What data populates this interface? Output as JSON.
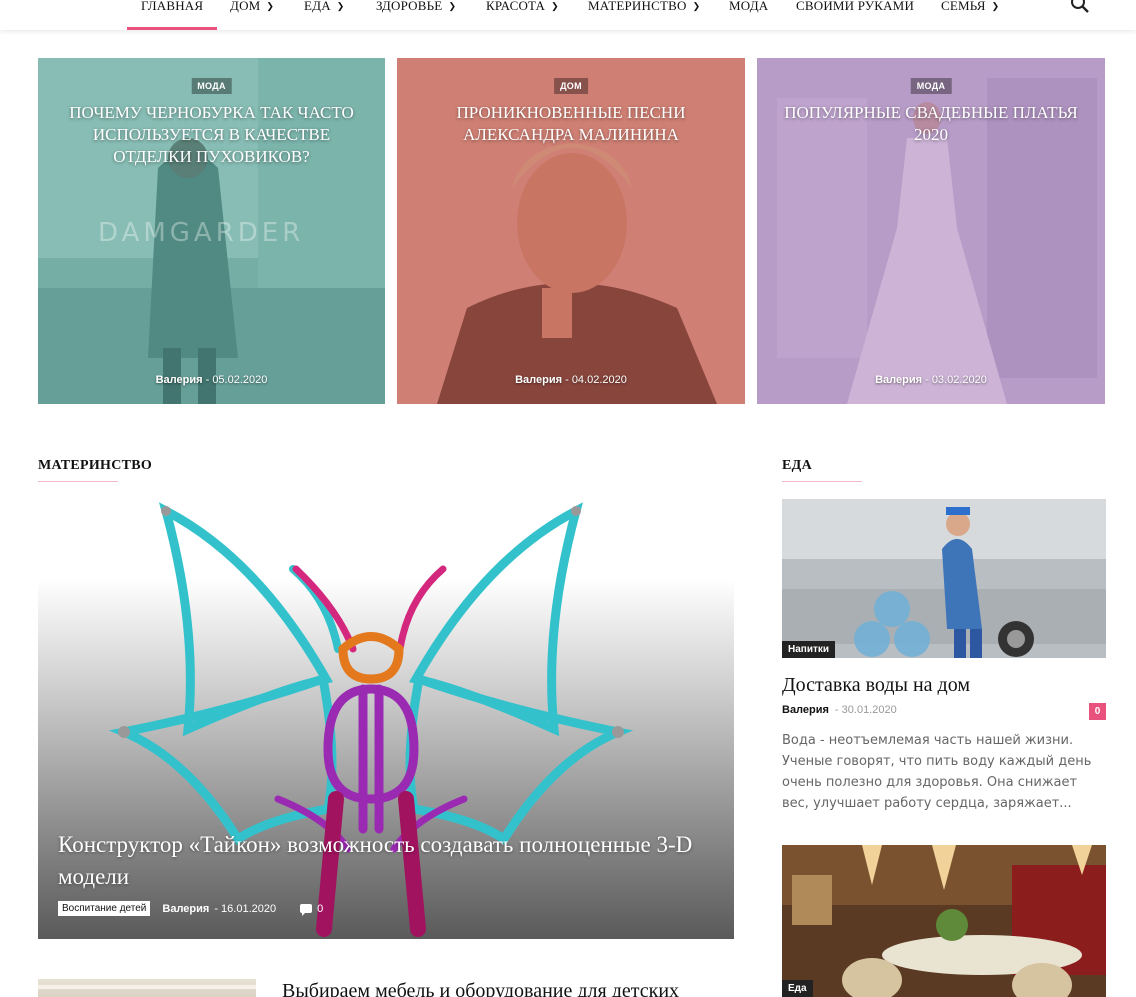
{
  "nav": {
    "items": [
      {
        "label": "ГЛАВНАЯ",
        "active": true,
        "dropdown": false
      },
      {
        "label": "ДОМ",
        "dropdown": true
      },
      {
        "label": "ЕДА",
        "dropdown": true
      },
      {
        "label": "ЗДОРОВЬЕ",
        "dropdown": true
      },
      {
        "label": "КРАСОТА",
        "dropdown": true
      },
      {
        "label": "МАТЕРИНСТВО",
        "dropdown": true
      },
      {
        "label": "МОДА",
        "dropdown": false
      },
      {
        "label": "СВОИМИ РУКАМИ",
        "dropdown": false
      },
      {
        "label": "СЕМЬЯ",
        "dropdown": true
      }
    ],
    "search_icon": "search-icon",
    "accent": "#e9527d"
  },
  "hero": [
    {
      "category": "МОДА",
      "title": "ПОЧЕМУ ЧЕРНОБУРКА ТАК ЧАСТО ИСПОЛЬЗУЕТСЯ В КАЧЕСТВЕ ОТДЕЛКИ ПУХОВИКОВ?",
      "author": "Валерия",
      "date": "05.02.2020",
      "overlay": "#5fb3a8",
      "watermark": "DAMGARDER"
    },
    {
      "category": "ДОМ",
      "title": "ПРОНИКНОВЕННЫЕ ПЕСНИ АЛЕКСАНДРА МАЛИНИНА",
      "author": "Валерия",
      "date": "04.02.2020",
      "overlay": "#c96558"
    },
    {
      "category": "МОДА",
      "title": "ПОПУЛЯРНЫЕ СВАДЕБНЫЕ ПЛАТЬЯ 2020",
      "author": "Валерия",
      "date": "03.02.2020",
      "overlay": "#a571b5"
    }
  ],
  "sections": {
    "left_title": "МАТЕРИНСТВО",
    "right_title": "ЕДА"
  },
  "feature": {
    "title": "Конструктор «Тайкон» возможность создавать полноценные 3-D модели",
    "tag": "Воспитание детей",
    "author": "Валерия",
    "date": "16.01.2020",
    "comments": "0"
  },
  "teaser": {
    "title": "Выбираем мебель и оборудование для детских"
  },
  "side": {
    "article1": {
      "tag": "Напитки",
      "title": "Доставка воды на дом",
      "author": "Валерия",
      "date": "30.01.2020",
      "comments": "0",
      "excerpt": "Вода - неотъемлемая часть нашей жизни. Ученые говорят, что пить воду каждый день очень полезно для здоровья. Она снижает вес, улучшает работу сердца, заряжает..."
    },
    "article2": {
      "tag": "Еда"
    }
  }
}
